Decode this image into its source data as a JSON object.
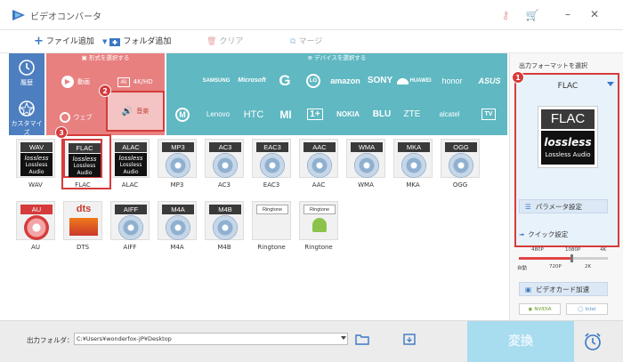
{
  "window": {
    "title": "ビデオコンバータ"
  },
  "toolbar": {
    "add_file": "ファイル追加",
    "add_folder": "フォルダ追加",
    "clear": "クリア",
    "merge": "マージ"
  },
  "left_nav": {
    "history": "履歴",
    "customize": "カスタマイズ"
  },
  "category": {
    "header": "形式を選択する",
    "video": "動画",
    "hd": "4K/HD",
    "web": "ウェブ",
    "music": "音楽"
  },
  "devices": {
    "header": "デバイスを選択する",
    "brands": [
      "SAMSUNG",
      "Microsoft",
      "G",
      "LG",
      "amazon",
      "SONY",
      "HUAWEI",
      "honor",
      "ASUS",
      "Lenovo",
      "HTC",
      "MI",
      "1+",
      "NOKIA",
      "BLU",
      "ZTE",
      "alcatel",
      "TV"
    ]
  },
  "formats": [
    {
      "label": "WAV",
      "badge": "WAV",
      "kind": "lossless"
    },
    {
      "label": "FLAC",
      "badge": "FLAC",
      "kind": "lossless"
    },
    {
      "label": "ALAC",
      "badge": "ALAC",
      "kind": "lossless"
    },
    {
      "label": "MP3",
      "badge": "MP3",
      "kind": "disc"
    },
    {
      "label": "AC3",
      "badge": "AC3",
      "kind": "disc"
    },
    {
      "label": "EAC3",
      "badge": "EAC3",
      "kind": "disc"
    },
    {
      "label": "AAC",
      "badge": "AAC",
      "kind": "disc"
    },
    {
      "label": "WMA",
      "badge": "WMA",
      "kind": "disc"
    },
    {
      "label": "MKA",
      "badge": "MKA",
      "kind": "disc"
    },
    {
      "label": "OGG",
      "badge": "OGG",
      "kind": "disc"
    },
    {
      "label": "AU",
      "badge": "AU",
      "kind": "au"
    },
    {
      "label": "DTS",
      "badge": "dts",
      "kind": "dts"
    },
    {
      "label": "AIFF",
      "badge": "AIFF",
      "kind": "disc"
    },
    {
      "label": "M4A",
      "badge": "M4A",
      "kind": "disc"
    },
    {
      "label": "M4B",
      "badge": "M4B",
      "kind": "disc"
    },
    {
      "label": "Ringtone",
      "badge": "Ringtone",
      "kind": "apple"
    },
    {
      "label": "Ringtone",
      "badge": "Ringtone",
      "kind": "android"
    }
  ],
  "format_lossless_text": {
    "logo": "lossless",
    "line1": "Lossless",
    "line2": "Audio"
  },
  "output_panel": {
    "title": "出力フォーマットを選択",
    "selected": "FLAC",
    "logo_big": "FLAC",
    "logo_small": "lossless",
    "logo_caption": "Lossless Audio",
    "params_button": "パラメータ設定",
    "quick_setting": "クイック設定",
    "quality_top": [
      "480P",
      "1080P",
      "4K"
    ],
    "quality_bottom": [
      "自動",
      "720P",
      "2K"
    ],
    "gpu_accel": "ビデオカード加速",
    "nvidia": "NVIDIA",
    "intel": "Intel"
  },
  "bottom": {
    "output_folder_label": "出力フォルダ：",
    "output_path": "C:¥Users¥wonderfox-JP¥Desktop",
    "convert": "変換"
  },
  "callouts": [
    "1",
    "2",
    "3"
  ],
  "colors": {
    "accent_red": "#d63b3b",
    "category_red": "#e88080",
    "device_teal": "#5fb8c2",
    "nav_blue": "#4d7fc0",
    "convert_blue": "#a8dcef"
  }
}
